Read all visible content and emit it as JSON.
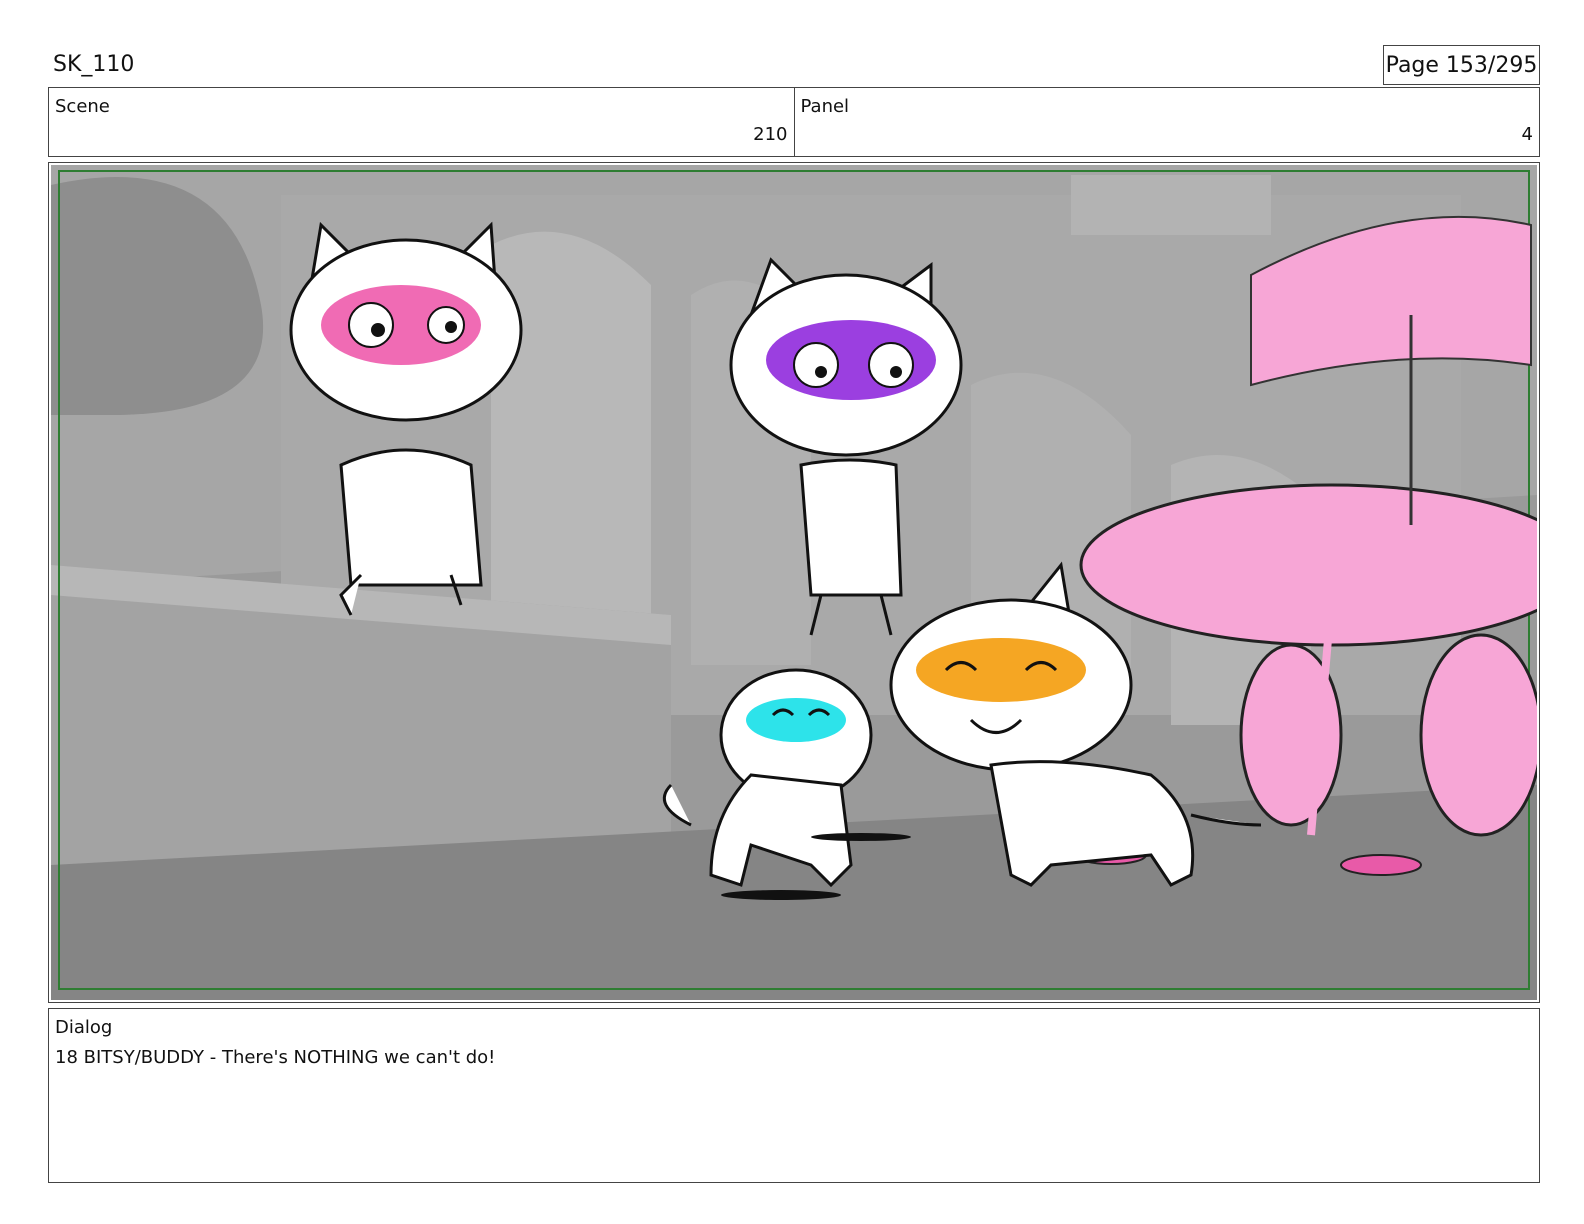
{
  "header": {
    "title": "SK_110",
    "page": "Page 153/295"
  },
  "meta": {
    "scene_label": "Scene",
    "scene_value": "210",
    "panel_label": "Panel",
    "panel_value": "4"
  },
  "dialog": {
    "label": "Dialog",
    "text": "18 BITSY/BUDDY - There's NOTHING we can't do!"
  },
  "colors": {
    "frame_border": "#2e7d32",
    "cat_pink_mask": "#f06bb4",
    "cat_purple_mask": "#9b3fe0",
    "cat_cyan_mask": "#2de3ea",
    "cat_orange_mask": "#f5a623",
    "cart_pink": "#f7a6d6"
  },
  "icons": {
    "illustration": "storyboard-sketch"
  }
}
